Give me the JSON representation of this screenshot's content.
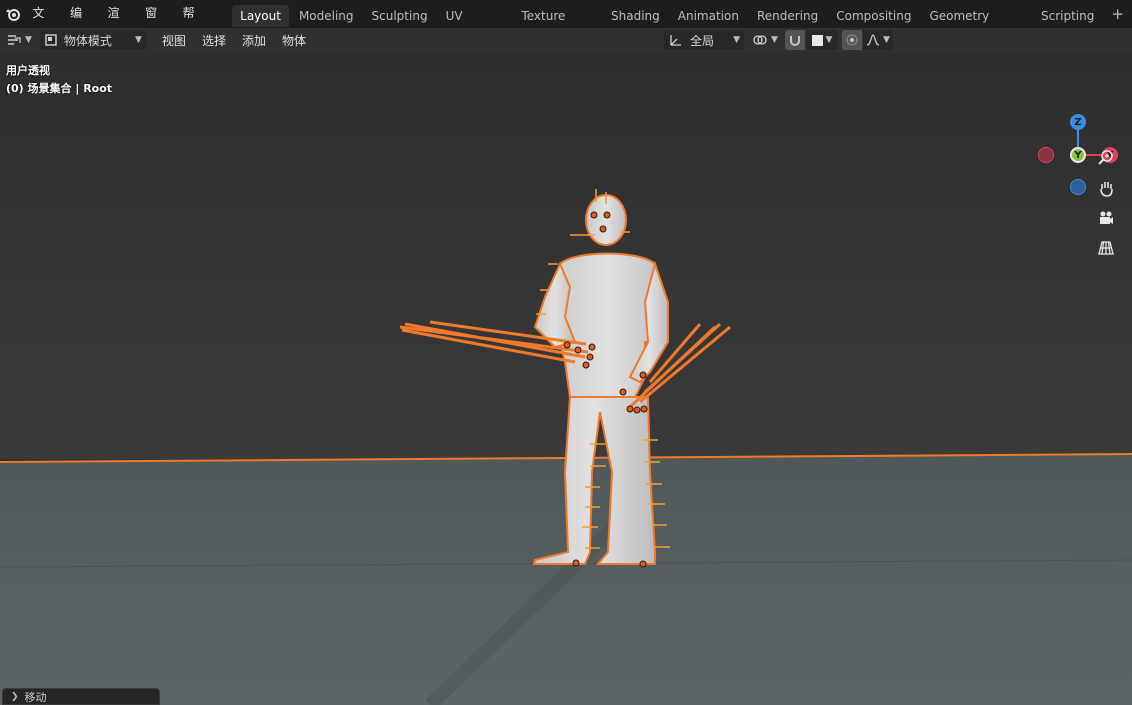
{
  "topbar": {
    "menus": [
      "文件",
      "编辑",
      "渲染",
      "窗口",
      "帮助"
    ],
    "workspaces": [
      "Layout",
      "Modeling",
      "Sculpting",
      "UV Editing",
      "Texture Paint",
      "Shading",
      "Animation",
      "Rendering",
      "Compositing",
      "Geometry Nodes",
      "Scripting"
    ],
    "active_workspace": "Layout",
    "add_tab": "+"
  },
  "header": {
    "mode": "物体模式",
    "menus": [
      "视图",
      "选择",
      "添加",
      "物体"
    ],
    "transform_orientation": "全局"
  },
  "viewport": {
    "view_name": "用户透视",
    "collection_info": "(0) 场景集合 | Root"
  },
  "gizmo": {
    "x_label": "X",
    "y_label": "Y",
    "z_label": "Z",
    "colors": {
      "x": "#e5405a",
      "y": "#8bc33a",
      "z": "#3b8de4"
    }
  },
  "operator_panel": {
    "label": "移动"
  },
  "colors": {
    "selection_outline": "#f07a2a",
    "bone": "#f0a030",
    "grid_floor": "#5b6466",
    "background": "#303030"
  }
}
